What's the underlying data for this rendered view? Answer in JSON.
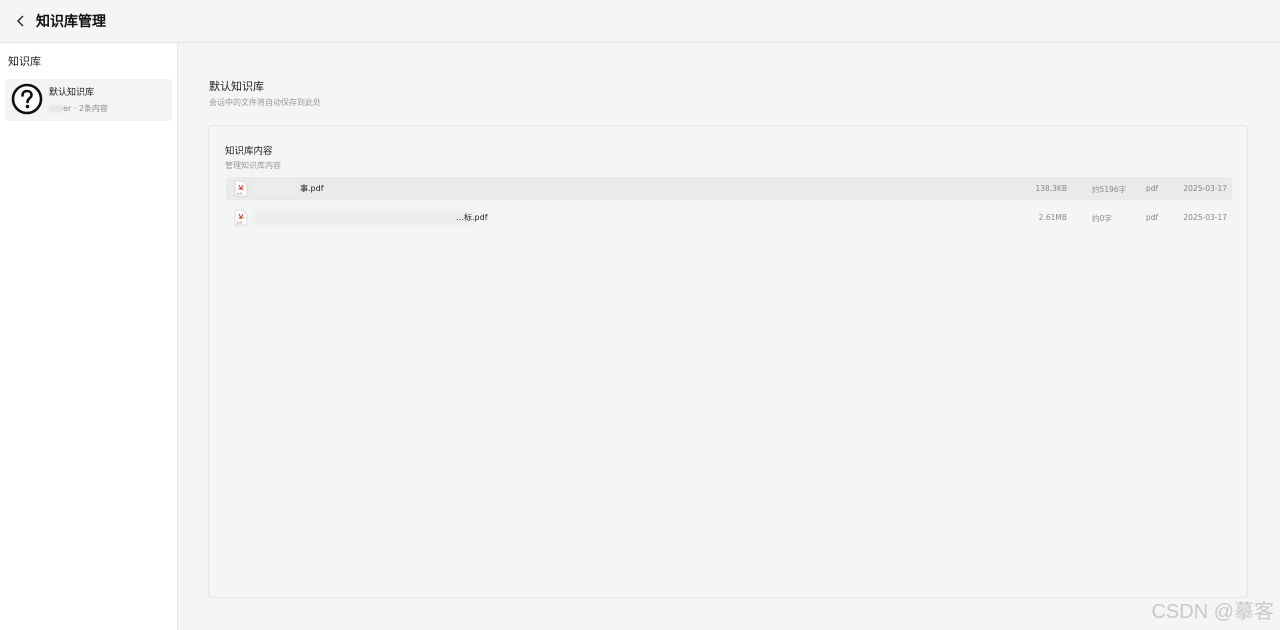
{
  "header": {
    "title": "知识库管理",
    "back_icon": "chevron-left-icon"
  },
  "sidebar": {
    "title": "知识库",
    "items": [
      {
        "name": "默认知识库",
        "meta_suffix": "er · 2条内容",
        "icon": "help-circle-icon"
      }
    ]
  },
  "main": {
    "title": "默认知识库",
    "description": "会话中的文件将自动保存到此处",
    "panel": {
      "title": "知识库内容",
      "description": "管理知识库内容",
      "files": [
        {
          "name": "事.pdf",
          "size": "138.3KB",
          "words": "约5196字",
          "type": "pdf",
          "date": "2025-03-17"
        },
        {
          "name": "…标.pdf",
          "size": "2.61MB",
          "words": "约0字",
          "type": "pdf",
          "date": "2025-03-17"
        }
      ]
    }
  },
  "watermark": "CSDN @摹客"
}
